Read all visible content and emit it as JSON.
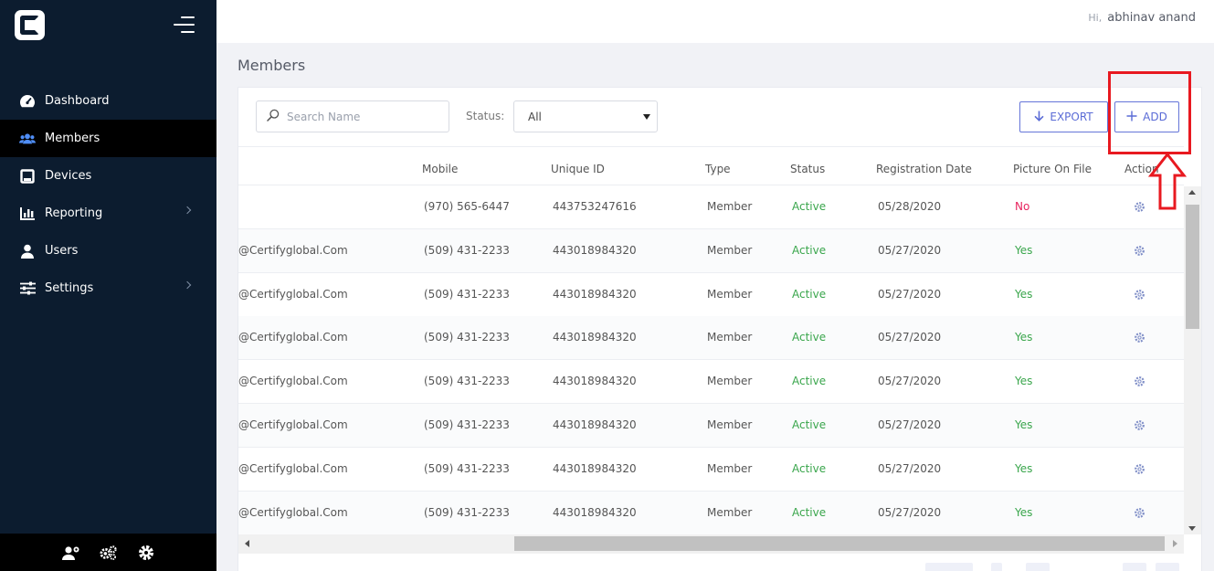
{
  "app": {
    "logo_name": "certify-logo"
  },
  "header": {
    "greeting_prefix": "Hi,",
    "user_name": "abhinav anand"
  },
  "sidebar": {
    "items": [
      {
        "label": "Dashboard",
        "icon": "dashboard-icon",
        "active": false,
        "has_submenu": false
      },
      {
        "label": "Members",
        "icon": "members-icon",
        "active": true,
        "has_submenu": false
      },
      {
        "label": "Devices",
        "icon": "devices-icon",
        "active": false,
        "has_submenu": false
      },
      {
        "label": "Reporting",
        "icon": "reporting-icon",
        "active": false,
        "has_submenu": true
      },
      {
        "label": "Users",
        "icon": "user-icon",
        "active": false,
        "has_submenu": false
      },
      {
        "label": "Settings",
        "icon": "settings-sliders-icon",
        "active": false,
        "has_submenu": true
      }
    ],
    "footer_icons": [
      "user-settings-icon",
      "cogs-icon",
      "gear-icon"
    ]
  },
  "page": {
    "title": "Members"
  },
  "toolbar": {
    "search_placeholder": "Search Name",
    "status_label": "Status:",
    "status_value": "All",
    "export_label": "EXPORT",
    "add_label": "ADD"
  },
  "table": {
    "columns": [
      "Mobile",
      "Unique ID",
      "Type",
      "Status",
      "Registration Date",
      "Picture On File",
      "Action"
    ],
    "rows": [
      {
        "email": "",
        "mobile": "(970) 565-6447",
        "unique_id": "443753247616",
        "type": "Member",
        "status": "Active",
        "reg_date": "05/28/2020",
        "picture": "No"
      },
      {
        "email": "@Certifyglobal.Com",
        "mobile": "(509) 431-2233",
        "unique_id": "443018984320",
        "type": "Member",
        "status": "Active",
        "reg_date": "05/27/2020",
        "picture": "Yes"
      },
      {
        "email": "@Certifyglobal.Com",
        "mobile": "(509) 431-2233",
        "unique_id": "443018984320",
        "type": "Member",
        "status": "Active",
        "reg_date": "05/27/2020",
        "picture": "Yes"
      },
      {
        "email": "@Certifyglobal.Com",
        "mobile": "(509) 431-2233",
        "unique_id": "443018984320",
        "type": "Member",
        "status": "Active",
        "reg_date": "05/27/2020",
        "picture": "Yes"
      },
      {
        "email": "@Certifyglobal.Com",
        "mobile": "(509) 431-2233",
        "unique_id": "443018984320",
        "type": "Member",
        "status": "Active",
        "reg_date": "05/27/2020",
        "picture": "Yes"
      },
      {
        "email": "@Certifyglobal.Com",
        "mobile": "(509) 431-2233",
        "unique_id": "443018984320",
        "type": "Member",
        "status": "Active",
        "reg_date": "05/27/2020",
        "picture": "Yes"
      },
      {
        "email": "@Certifyglobal.Com",
        "mobile": "(509) 431-2233",
        "unique_id": "443018984320",
        "type": "Member",
        "status": "Active",
        "reg_date": "05/27/2020",
        "picture": "Yes"
      },
      {
        "email": "@Certifyglobal.Com",
        "mobile": "(509) 431-2233",
        "unique_id": "443018984320",
        "type": "Member",
        "status": "Active",
        "reg_date": "05/27/2020",
        "picture": "Yes"
      }
    ]
  },
  "annotation": {
    "highlight_color": "#e81920",
    "target": "add-button"
  },
  "colors": {
    "sidebar_bg": "#0c1c2f",
    "accent": "#5a6bd6",
    "status_active": "#3aa64c",
    "picture_no": "#e8245f"
  }
}
